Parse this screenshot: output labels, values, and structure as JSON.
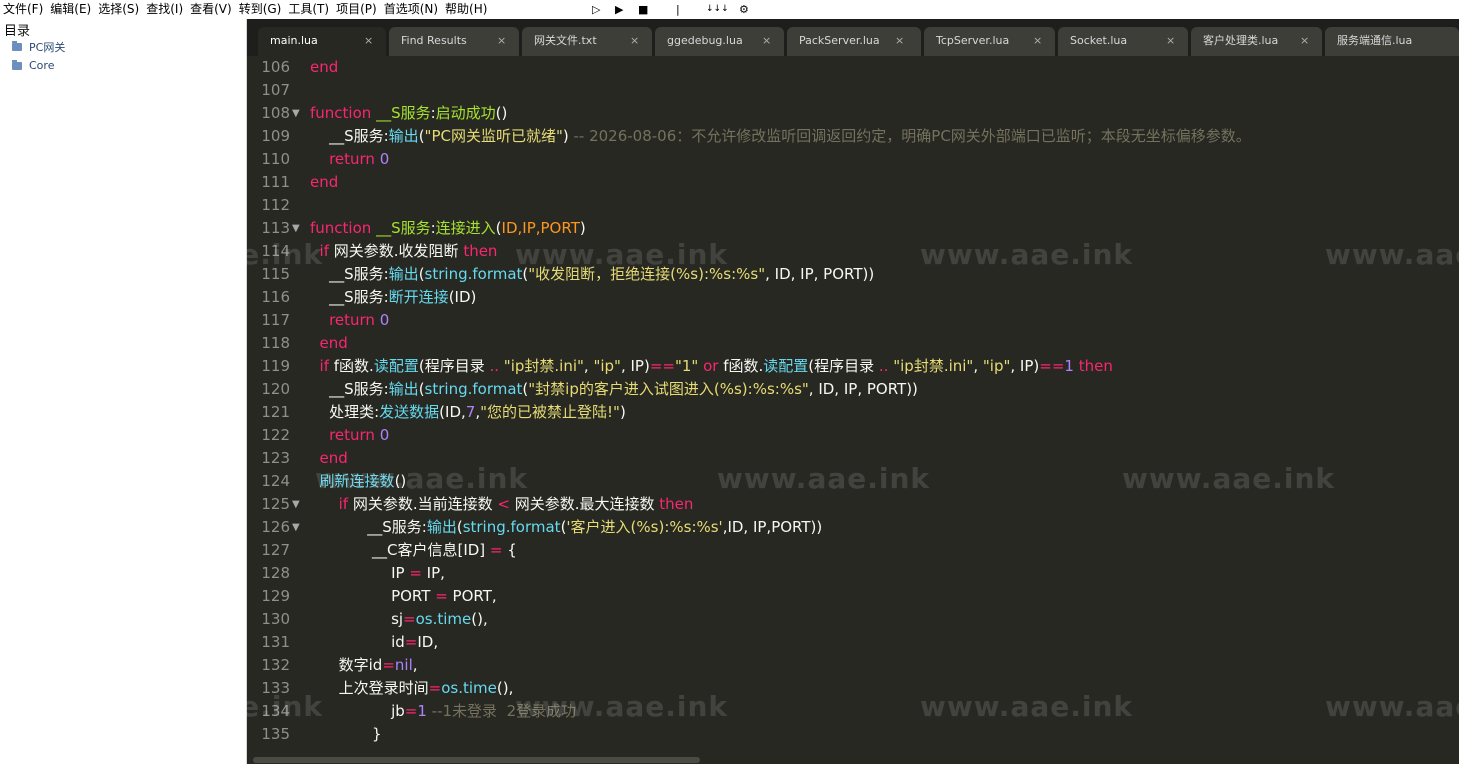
{
  "menu": [
    "文件(F)",
    "编辑(E)",
    "选择(S)",
    "查找(I)",
    "查看(V)",
    "转到(G)",
    "工具(T)",
    "项目(P)",
    "首选项(N)",
    "帮助(H)"
  ],
  "toolbar": {
    "play": "▷",
    "run": "▶",
    "stop": "■",
    "sep": "|",
    "sort": "↓↓↓",
    "settings": "⚙"
  },
  "sidebar": {
    "title": "目录",
    "items": [
      {
        "label": "PC网关"
      },
      {
        "label": "Core"
      }
    ]
  },
  "tabs": [
    {
      "label": "main.lua",
      "close": "×"
    },
    {
      "label": "Find Results",
      "close": "×"
    },
    {
      "label": "网关文件.txt",
      "close": "×"
    },
    {
      "label": "ggedebug.lua",
      "close": "×"
    },
    {
      "label": "PackServer.lua",
      "close": "×"
    },
    {
      "label": "TcpServer.lua",
      "close": "×"
    },
    {
      "label": "Socket.lua",
      "close": "×"
    },
    {
      "label": "客户处理类.lua",
      "close": "×"
    },
    {
      "label": "服务端通信.lua",
      "close": ""
    }
  ],
  "watermark": "www.aae.ink",
  "fold_marker": "▼",
  "code_lines": [
    {
      "num": "106",
      "fold": false,
      "indent": "",
      "tokens": [
        {
          "t": "end",
          "c": "k"
        }
      ]
    },
    {
      "num": "107",
      "fold": false,
      "indent": "",
      "tokens": []
    },
    {
      "num": "108",
      "fold": true,
      "indent": "",
      "tokens": [
        {
          "t": "function",
          "c": "k"
        },
        {
          "t": " ",
          "c": "w"
        },
        {
          "t": "__S服务",
          "c": "fn"
        },
        {
          "t": ":",
          "c": "w"
        },
        {
          "t": "启动成功",
          "c": "fn"
        },
        {
          "t": "()",
          "c": "w"
        }
      ]
    },
    {
      "num": "109",
      "fold": false,
      "indent": "    ",
      "tokens": [
        {
          "t": "__S服务",
          "c": "w"
        },
        {
          "t": ":",
          "c": "w"
        },
        {
          "t": "输出",
          "c": "f"
        },
        {
          "t": "(",
          "c": "w"
        },
        {
          "t": "\"PC网关监听已就绪\"",
          "c": "s"
        },
        {
          "t": ") ",
          "c": "w"
        },
        {
          "t": "-- 2026-08-06：不允许修改监听回调返回约定，明确PC网关外部端口已监听；本段无坐标偏移参数。",
          "c": "c"
        }
      ]
    },
    {
      "num": "110",
      "fold": false,
      "indent": "    ",
      "tokens": [
        {
          "t": "return",
          "c": "k"
        },
        {
          "t": " ",
          "c": "w"
        },
        {
          "t": "0",
          "c": "n"
        }
      ]
    },
    {
      "num": "111",
      "fold": false,
      "indent": "",
      "tokens": [
        {
          "t": "end",
          "c": "k"
        }
      ]
    },
    {
      "num": "112",
      "fold": false,
      "indent": "",
      "tokens": []
    },
    {
      "num": "113",
      "fold": true,
      "indent": "",
      "tokens": [
        {
          "t": "function",
          "c": "k"
        },
        {
          "t": " ",
          "c": "w"
        },
        {
          "t": "__S服务",
          "c": "fn"
        },
        {
          "t": ":",
          "c": "w"
        },
        {
          "t": "连接进入",
          "c": "fn"
        },
        {
          "t": "(",
          "c": "w"
        },
        {
          "t": "ID,IP,PORT",
          "c": "p"
        },
        {
          "t": ")",
          "c": "w"
        }
      ]
    },
    {
      "num": "114",
      "fold": false,
      "indent": "  ",
      "tokens": [
        {
          "t": "if",
          "c": "k"
        },
        {
          "t": " 网关参数.收发阻断 ",
          "c": "w"
        },
        {
          "t": "then",
          "c": "k"
        }
      ]
    },
    {
      "num": "115",
      "fold": false,
      "indent": "    ",
      "tokens": [
        {
          "t": "__S服务",
          "c": "w"
        },
        {
          "t": ":",
          "c": "w"
        },
        {
          "t": "输出",
          "c": "f"
        },
        {
          "t": "(",
          "c": "w"
        },
        {
          "t": "string.format",
          "c": "f"
        },
        {
          "t": "(",
          "c": "w"
        },
        {
          "t": "\"收发阻断，拒绝连接(%s):%s:%s\"",
          "c": "s"
        },
        {
          "t": ", ID, IP, PORT))",
          "c": "w"
        }
      ]
    },
    {
      "num": "116",
      "fold": false,
      "indent": "    ",
      "tokens": [
        {
          "t": "__S服务",
          "c": "w"
        },
        {
          "t": ":",
          "c": "w"
        },
        {
          "t": "断开连接",
          "c": "f"
        },
        {
          "t": "(ID)",
          "c": "w"
        }
      ]
    },
    {
      "num": "117",
      "fold": false,
      "indent": "    ",
      "tokens": [
        {
          "t": "return",
          "c": "k"
        },
        {
          "t": " ",
          "c": "w"
        },
        {
          "t": "0",
          "c": "n"
        }
      ]
    },
    {
      "num": "118",
      "fold": false,
      "indent": "  ",
      "tokens": [
        {
          "t": "end",
          "c": "k"
        }
      ]
    },
    {
      "num": "119",
      "fold": false,
      "indent": "  ",
      "tokens": [
        {
          "t": "if",
          "c": "k"
        },
        {
          "t": " f函数.",
          "c": "w"
        },
        {
          "t": "读配置",
          "c": "f"
        },
        {
          "t": "(程序目录 ",
          "c": "w"
        },
        {
          "t": "..",
          "c": "o"
        },
        {
          "t": " ",
          "c": "w"
        },
        {
          "t": "\"ip封禁.ini\"",
          "c": "s"
        },
        {
          "t": ", ",
          "c": "w"
        },
        {
          "t": "\"ip\"",
          "c": "s"
        },
        {
          "t": ", IP)",
          "c": "w"
        },
        {
          "t": "==",
          "c": "o"
        },
        {
          "t": "\"1\"",
          "c": "s"
        },
        {
          "t": " ",
          "c": "w"
        },
        {
          "t": "or",
          "c": "k"
        },
        {
          "t": " f函数.",
          "c": "w"
        },
        {
          "t": "读配置",
          "c": "f"
        },
        {
          "t": "(程序目录 ",
          "c": "w"
        },
        {
          "t": "..",
          "c": "o"
        },
        {
          "t": " ",
          "c": "w"
        },
        {
          "t": "\"ip封禁.ini\"",
          "c": "s"
        },
        {
          "t": ", ",
          "c": "w"
        },
        {
          "t": "\"ip\"",
          "c": "s"
        },
        {
          "t": ", IP)",
          "c": "w"
        },
        {
          "t": "==",
          "c": "o"
        },
        {
          "t": "1",
          "c": "n"
        },
        {
          "t": " ",
          "c": "w"
        },
        {
          "t": "then",
          "c": "k"
        }
      ]
    },
    {
      "num": "120",
      "fold": false,
      "indent": "    ",
      "tokens": [
        {
          "t": "__S服务",
          "c": "w"
        },
        {
          "t": ":",
          "c": "w"
        },
        {
          "t": "输出",
          "c": "f"
        },
        {
          "t": "(",
          "c": "w"
        },
        {
          "t": "string.format",
          "c": "f"
        },
        {
          "t": "(",
          "c": "w"
        },
        {
          "t": "\"封禁ip的客户进入试图进入(%s):%s:%s\"",
          "c": "s"
        },
        {
          "t": ", ID, IP, PORT))",
          "c": "w"
        }
      ]
    },
    {
      "num": "121",
      "fold": false,
      "indent": "    ",
      "tokens": [
        {
          "t": "处理类",
          "c": "w"
        },
        {
          "t": ":",
          "c": "w"
        },
        {
          "t": "发送数据",
          "c": "f"
        },
        {
          "t": "(ID,",
          "c": "w"
        },
        {
          "t": "7",
          "c": "n"
        },
        {
          "t": ",",
          "c": "w"
        },
        {
          "t": "\"您的已被禁止登陆!\"",
          "c": "s"
        },
        {
          "t": ")",
          "c": "w"
        }
      ]
    },
    {
      "num": "122",
      "fold": false,
      "indent": "    ",
      "tokens": [
        {
          "t": "return",
          "c": "k"
        },
        {
          "t": " ",
          "c": "w"
        },
        {
          "t": "0",
          "c": "n"
        }
      ]
    },
    {
      "num": "123",
      "fold": false,
      "indent": "  ",
      "tokens": [
        {
          "t": "end",
          "c": "k"
        }
      ]
    },
    {
      "num": "124",
      "fold": false,
      "indent": "  ",
      "tokens": [
        {
          "t": "刷新连接数",
          "c": "f"
        },
        {
          "t": "()",
          "c": "w"
        }
      ]
    },
    {
      "num": "125",
      "fold": true,
      "indent": "      ",
      "tokens": [
        {
          "t": "if",
          "c": "k"
        },
        {
          "t": " 网关参数.当前连接数 ",
          "c": "w"
        },
        {
          "t": "<",
          "c": "o"
        },
        {
          "t": " 网关参数.最大连接数 ",
          "c": "w"
        },
        {
          "t": "then",
          "c": "k"
        }
      ]
    },
    {
      "num": "126",
      "fold": true,
      "indent": "            ",
      "tokens": [
        {
          "t": "__S服务",
          "c": "w"
        },
        {
          "t": ":",
          "c": "w"
        },
        {
          "t": "输出",
          "c": "f"
        },
        {
          "t": "(",
          "c": "w"
        },
        {
          "t": "string.format",
          "c": "f"
        },
        {
          "t": "(",
          "c": "w"
        },
        {
          "t": "'客户进入(%s):%s:%s'",
          "c": "s"
        },
        {
          "t": ",ID, IP,PORT))",
          "c": "w"
        }
      ]
    },
    {
      "num": "127",
      "fold": false,
      "indent": "             ",
      "tokens": [
        {
          "t": "__C客户信息[ID] ",
          "c": "w"
        },
        {
          "t": "=",
          "c": "o"
        },
        {
          "t": " {",
          "c": "w"
        }
      ]
    },
    {
      "num": "128",
      "fold": false,
      "indent": "                 ",
      "tokens": [
        {
          "t": "IP ",
          "c": "w"
        },
        {
          "t": "=",
          "c": "o"
        },
        {
          "t": " IP,",
          "c": "w"
        }
      ]
    },
    {
      "num": "129",
      "fold": false,
      "indent": "                 ",
      "tokens": [
        {
          "t": "PORT ",
          "c": "w"
        },
        {
          "t": "=",
          "c": "o"
        },
        {
          "t": " PORT,",
          "c": "w"
        }
      ]
    },
    {
      "num": "130",
      "fold": false,
      "indent": "                 ",
      "tokens": [
        {
          "t": "sj",
          "c": "w"
        },
        {
          "t": "=",
          "c": "o"
        },
        {
          "t": "os.time",
          "c": "f"
        },
        {
          "t": "(),",
          "c": "w"
        }
      ]
    },
    {
      "num": "131",
      "fold": false,
      "indent": "                 ",
      "tokens": [
        {
          "t": "id",
          "c": "w"
        },
        {
          "t": "=",
          "c": "o"
        },
        {
          "t": "ID,",
          "c": "w"
        }
      ]
    },
    {
      "num": "132",
      "fold": false,
      "indent": "      ",
      "tokens": [
        {
          "t": "数字id",
          "c": "w"
        },
        {
          "t": "=",
          "c": "o"
        },
        {
          "t": "nil",
          "c": "n"
        },
        {
          "t": ",",
          "c": "w"
        }
      ]
    },
    {
      "num": "133",
      "fold": false,
      "indent": "      ",
      "tokens": [
        {
          "t": "上次登录时间",
          "c": "w"
        },
        {
          "t": "=",
          "c": "o"
        },
        {
          "t": "os.time",
          "c": "f"
        },
        {
          "t": "(),",
          "c": "w"
        }
      ]
    },
    {
      "num": "134",
      "fold": false,
      "indent": "                 ",
      "tokens": [
        {
          "t": "jb",
          "c": "w"
        },
        {
          "t": "=",
          "c": "o"
        },
        {
          "t": "1",
          "c": "n"
        },
        {
          "t": " ",
          "c": "w"
        },
        {
          "t": "--1未登录  2登录成功",
          "c": "c"
        }
      ]
    },
    {
      "num": "135",
      "fold": false,
      "indent": "             ",
      "tokens": [
        {
          "t": "}",
          "c": "w"
        }
      ]
    }
  ]
}
